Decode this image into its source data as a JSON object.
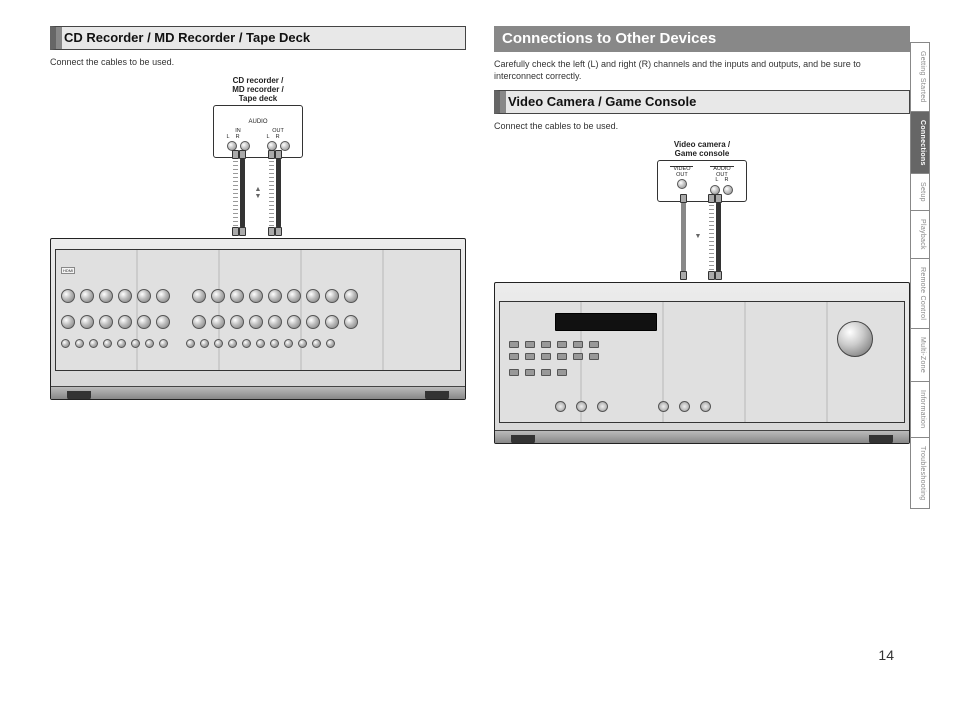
{
  "language": "ENGLISH",
  "page_number": "14",
  "left_column": {
    "heading": "CD Recorder / MD Recorder / Tape Deck",
    "instruction": "Connect the cables to be used.",
    "device_label": "CD recorder /\nMD recorder /\nTape deck",
    "panel": {
      "title": "AUDIO",
      "groups": [
        {
          "label": "IN",
          "channels": [
            "L",
            "R"
          ]
        },
        {
          "label": "OUT",
          "channels": [
            "L",
            "R"
          ]
        }
      ]
    }
  },
  "right_column": {
    "main_heading": "Connections to Other Devices",
    "main_instruction": "Carefully check the left (L) and right (R) channels and the inputs and outputs, and be sure to interconnect correctly.",
    "sub_heading": "Video Camera / Game Console",
    "sub_instruction": "Connect the cables to be used.",
    "device_label": "Video camera /\nGame console",
    "panel": {
      "groups": [
        {
          "title": "VIDEO",
          "label": "OUT",
          "jacks": 1
        },
        {
          "title": "AUDIO",
          "label": "OUT",
          "channels": [
            "L",
            "R"
          ]
        }
      ]
    }
  },
  "tabs": [
    {
      "label": "Getting Started",
      "active": false
    },
    {
      "label": "Connections",
      "active": true
    },
    {
      "label": "Setup",
      "active": false
    },
    {
      "label": "Playback",
      "active": false
    },
    {
      "label": "Remote Control",
      "active": false
    },
    {
      "label": "Multi-Zone",
      "active": false
    },
    {
      "label": "Information",
      "active": false
    },
    {
      "label": "Troubleshooting",
      "active": false
    }
  ]
}
